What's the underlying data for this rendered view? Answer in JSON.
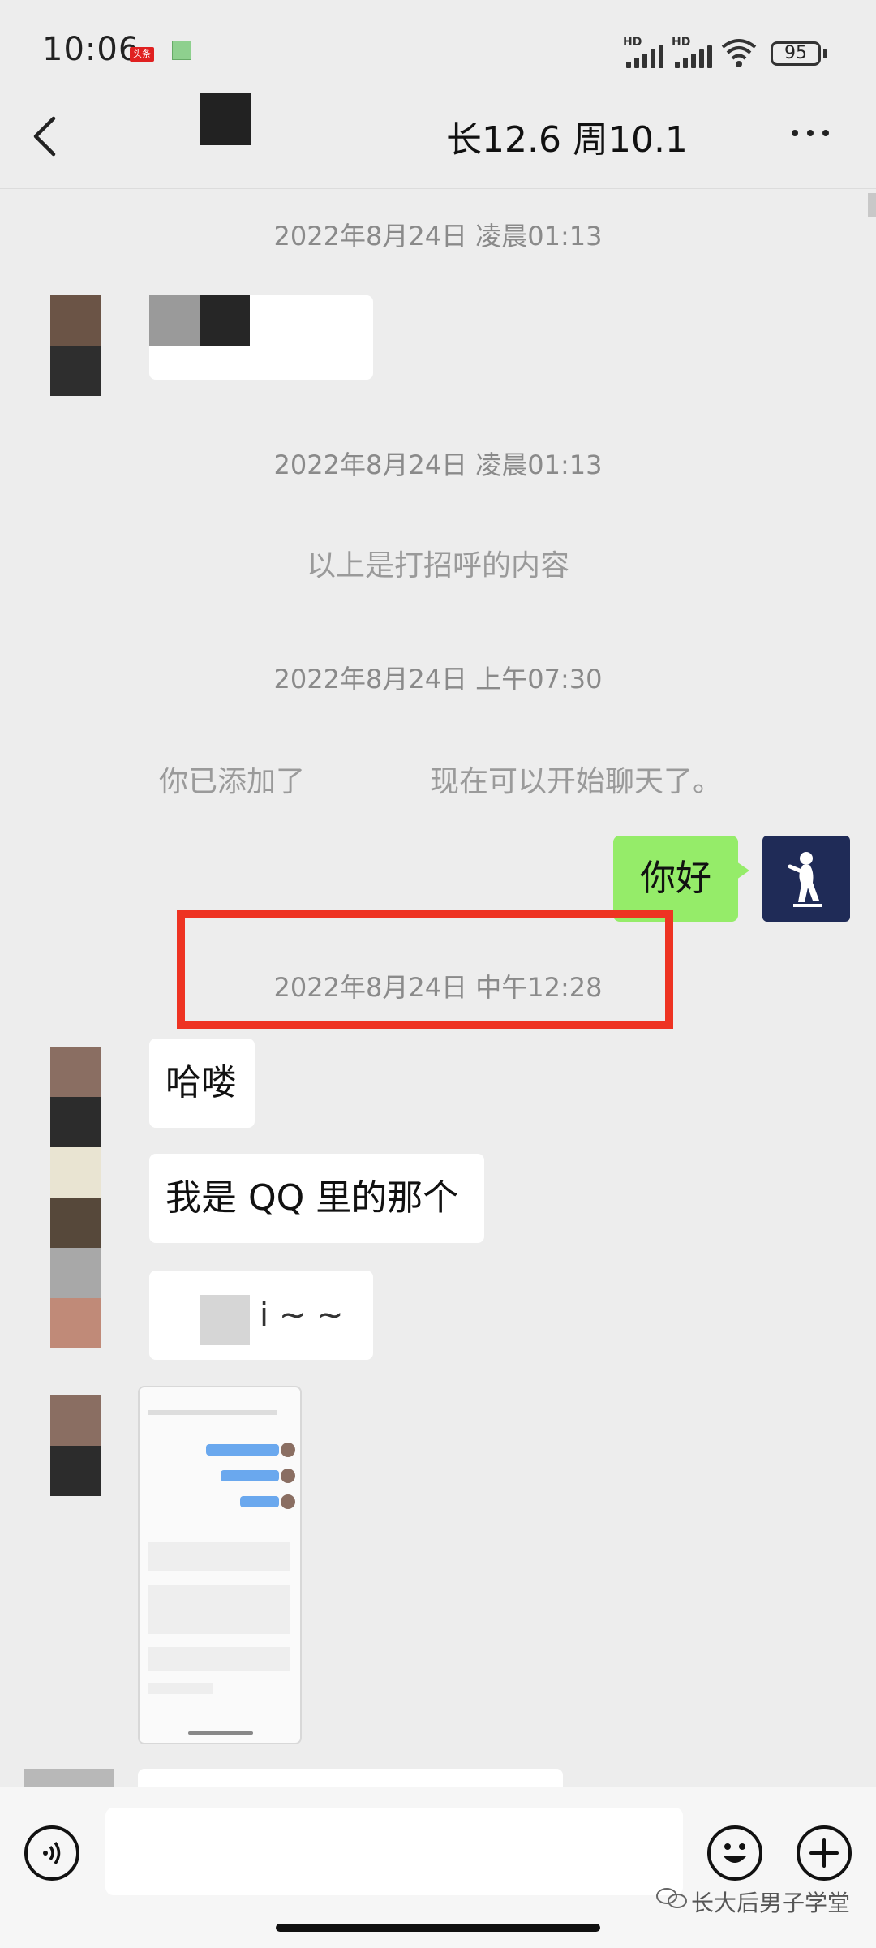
{
  "status_bar": {
    "time": "10:06",
    "news_tag": "头条",
    "hd1": "HD",
    "hd2": "HD",
    "battery": "95"
  },
  "nav": {
    "title": "长12.6 周10.1",
    "back_icon": "chevron-left-icon",
    "more_icon": "more-dots-icon"
  },
  "chat": {
    "ts1": "2022年8月24日 凌晨01:13",
    "ts2": "2022年8月24日 凌晨01:13",
    "sys_greeting": "以上是打招呼的内容",
    "ts3": "2022年8月24日 上午07:30",
    "sys_added_prefix": "你已添加了",
    "sys_added_suffix": "现在可以开始聊天了。",
    "my_msg": "你好",
    "ts4": "2022年8月24日 中午12:28",
    "msg1": "哈喽",
    "msg2": "我是 QQ 里的那个",
    "msg3_suffix": "i ~ ~"
  },
  "input_bar": {
    "voice_icon": "voice-icon",
    "emoji_icon": "emoji-icon",
    "plus_icon": "plus-icon"
  },
  "watermark": "长大后男子学堂",
  "colors": {
    "background": "#ededed",
    "my_bubble": "#95ec69",
    "highlight_box": "#ee3322"
  }
}
